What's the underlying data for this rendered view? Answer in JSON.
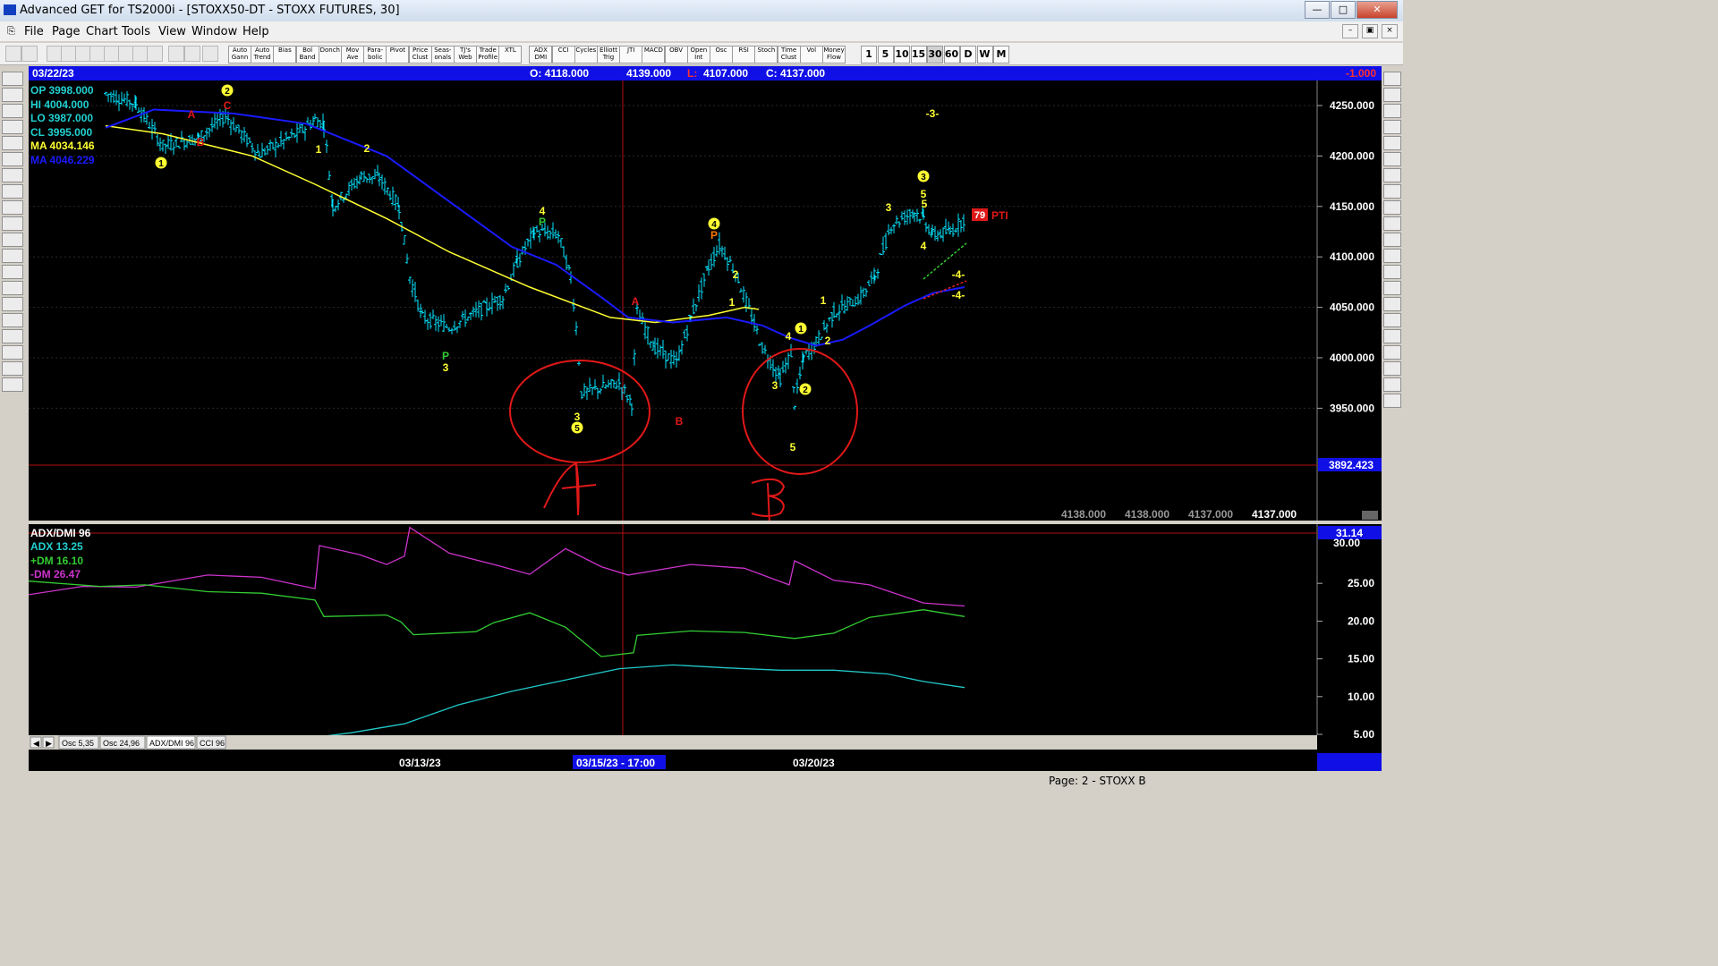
{
  "window": {
    "title": "Advanced GET for TS2000i - [STOXX50-DT - STOXX FUTURES, 30]"
  },
  "menu": [
    "File",
    "Page",
    "Chart",
    "Tools",
    "View",
    "Window",
    "Help"
  ],
  "toolbar": {
    "indicators": [
      "Auto Gann",
      "Auto Trend",
      "Bias",
      "Bol Band",
      "Donch",
      "Mov Ave",
      "Para-bolic",
      "Pivot",
      "Price Clust",
      "Seas-onals",
      "TJ's Web",
      "Trade Profile",
      "XTL",
      "ADX DMI",
      "CCI",
      "Cycles",
      "Elliott Trig",
      "JTI",
      "MACD",
      "OBV",
      "Open Int",
      "Osc",
      "RSI",
      "Stoch",
      "Time Clust",
      "Vol",
      "Money Flow"
    ],
    "timeframes": [
      "1",
      "5",
      "10",
      "15",
      "30",
      "60",
      "D",
      "W",
      "M"
    ]
  },
  "header": {
    "date": "03/22/23",
    "open": "O: 4118.000",
    "high": "4139.000",
    "low_label": "L:",
    "low": "4107.000",
    "close": "C: 4137.000",
    "change": "-1.000"
  },
  "info": {
    "op": "OP  3998.000",
    "hi": "HI   4004.000",
    "lo": "LO  3987.000",
    "cl": "CL  3995.000",
    "ma1": "MA  4034.146",
    "ma2": "MA  4046.229"
  },
  "price_axis": {
    "ticks": [
      "4250.000",
      "4200.000",
      "4150.000",
      "4100.000",
      "4050.000",
      "4000.000",
      "3950.000"
    ],
    "cursor": "3892.423"
  },
  "bottom_values": [
    "4138.000",
    "4138.000",
    "4137.000",
    "4137.000"
  ],
  "indicator": {
    "title": "ADX/DMI 96",
    "adx": "ADX 13.25",
    "pdm": "+DM 16.10",
    "mdm": "-DM  26.47",
    "ticks": [
      "25.00",
      "20.00",
      "15.00",
      "10.00",
      "5.00"
    ],
    "marker": "31.14",
    "top_tick": "30.00"
  },
  "tabs": [
    "Osc 5,35",
    "Osc 24,96",
    "ADX/DMI 96",
    "CCI 96"
  ],
  "date_axis": [
    "03/13/23",
    "03/15/23 - 17:00",
    "03/20/23"
  ],
  "annotations": {
    "waves": [
      "1",
      "2",
      "C",
      "A",
      "B",
      "1",
      "2",
      "4",
      "P",
      "P",
      "3",
      "3",
      "5",
      "4",
      "2",
      "1",
      "A",
      "B",
      "P",
      "5",
      "3",
      "4",
      "2",
      "3",
      "1",
      "2",
      "1",
      "5",
      "3",
      "5",
      "4",
      "-3-",
      "-4-",
      "-4-",
      "79",
      "PTI"
    ],
    "hand": [
      "A",
      "B"
    ]
  },
  "status": {
    "page": "Page: 2 - STOXX B"
  },
  "colors": {
    "ma_fast": "#ffff33",
    "ma_slow": "#1a1aff",
    "adx": "#22c8c8",
    "plus_dm": "#33cc33",
    "minus_dm": "#cc33cc",
    "header_bg": "#1010e6",
    "bars": "#00e5ff",
    "circles": "#e01818"
  }
}
